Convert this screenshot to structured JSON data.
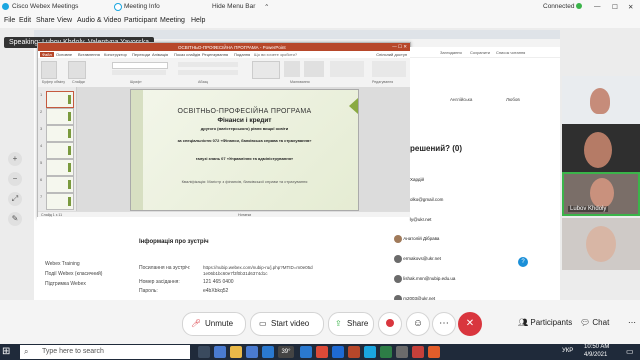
{
  "titlebar": {
    "app_title": "Cisco Webex Meetings",
    "meeting_info": "Meeting Info",
    "hide_menu_bar": "Hide Menu Bar",
    "connected": "Connected"
  },
  "menu": [
    "File",
    "Edit",
    "Share",
    "View",
    "Audio & Video",
    "Participant",
    "Meeting",
    "Help"
  ],
  "speaking": "Speaking: Lubov Khdoly, Valentyna Yavorska",
  "ppt": {
    "window_title": "ОСВІТНЬО-ПРОФЕСІЙНА ПРОГРАМА - PowerPoint",
    "ribbon_tabs": [
      "Файл",
      "Основне",
      "Вставлення",
      "Конструктор",
      "Переходи",
      "Анімація",
      "Показ слайдів",
      "Рецензування",
      "Подання"
    ],
    "search_hint": "Що ви хочете зробити?",
    "share_label": "Спільний доступ",
    "ribbon_groups": [
      "Буфер обміну",
      "Слайди",
      "Шрифт",
      "Абзац",
      "Малювання",
      "Редагування"
    ],
    "slide_numbers": [
      "1",
      "2",
      "3",
      "4",
      "5",
      "6",
      "7"
    ],
    "status_left": "Слайд 1 з 11",
    "status_notes": "Нотатки"
  },
  "slide": {
    "title": "ОСВІТНЬО-ПРОФЕСІЙНА ПРОГРАМА",
    "subtitle": "Фінанси і кредит",
    "line3": "другого (магістерського) рівня вищої освіти",
    "line4": "за спеціальністю 072 «Фінанси, банківська справа та страхування»",
    "line5": "галузі знань 07 «Управління та адміністрування»",
    "qualification": "Кваліфікація: Магістр з фінансів, банківської справи та страхування"
  },
  "lower_page": {
    "heading": "Інформація про зустріч",
    "links": [
      "Webex Training",
      "Події Webex (класичний)",
      "Підтримка Webex"
    ],
    "meeting_link_label": "Посилання на зустріч:",
    "meeting_link": "https://nubip.webex.com/nubip-ru/j.php?MTID=m0e05d1e06b1bc60e7f3f0b31d6374d1c",
    "meeting_number_label": "Номер засідання:",
    "meeting_number": "121 465 0400",
    "password_label": "Пароль:",
    "password": "e4bXbkq52"
  },
  "right_page": {
    "header_lang": "Англійська",
    "header_user": "Любов",
    "question_heading": "решений? (0)",
    "people": [
      {
        "name": "Хардій",
        "email": ""
      },
      {
        "name": "",
        "email": "olko@gmail.com"
      },
      {
        "name": "",
        "email": "ly@ukr.net"
      },
      {
        "name": "Анатолій Дібрава",
        "email": ""
      },
      {
        "name": "",
        "email": "ermakovs@ukr.net"
      },
      {
        "name": "",
        "email": "lishak.mnn@nubip.edu.ua"
      },
      {
        "name": "",
        "email": "m2003@ukr.net"
      }
    ],
    "top_links": [
      "Заглядання",
      "Сохранити",
      "Список читання"
    ]
  },
  "participants_panel": {
    "label_active": "Lubov Khdoly"
  },
  "controls": {
    "unmute": "Unmute",
    "start_video": "Start video",
    "share": "Share",
    "participants": "Participants",
    "chat": "Chat"
  },
  "taskbar": {
    "search_placeholder": "Type here to search",
    "weather": "39°",
    "lang": "УКР",
    "time": "10:50 AM",
    "date": "4/9/2021"
  },
  "colors": {
    "accent_red": "#b7472a",
    "webex_end_red": "#d9363e",
    "taskbar": "#1f2a3a"
  }
}
